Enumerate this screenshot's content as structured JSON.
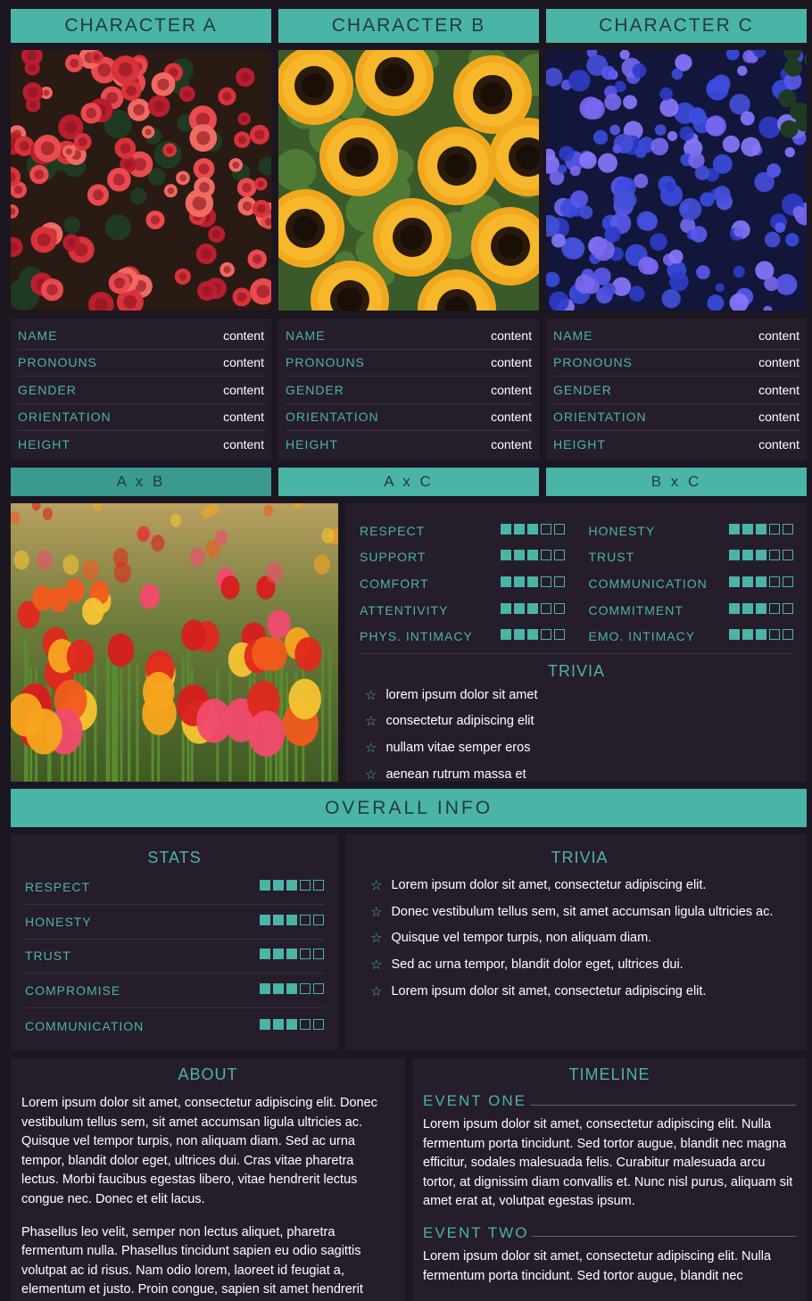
{
  "characters": [
    {
      "title": "CHARACTER A",
      "image": "red-begonia-photo",
      "fields": [
        {
          "label": "NAME",
          "value": "content"
        },
        {
          "label": "PRONOUNS",
          "value": "content"
        },
        {
          "label": "GENDER",
          "value": "content"
        },
        {
          "label": "ORIENTATION",
          "value": "content"
        },
        {
          "label": "HEIGHT",
          "value": "content"
        }
      ]
    },
    {
      "title": "CHARACTER B",
      "image": "sunflower-photo",
      "fields": [
        {
          "label": "NAME",
          "value": "content"
        },
        {
          "label": "PRONOUNS",
          "value": "content"
        },
        {
          "label": "GENDER",
          "value": "content"
        },
        {
          "label": "ORIENTATION",
          "value": "content"
        },
        {
          "label": "HEIGHT",
          "value": "content"
        }
      ]
    },
    {
      "title": "CHARACTER C",
      "image": "blue-hydrangea-photo",
      "fields": [
        {
          "label": "NAME",
          "value": "content"
        },
        {
          "label": "PRONOUNS",
          "value": "content"
        },
        {
          "label": "GENDER",
          "value": "content"
        },
        {
          "label": "ORIENTATION",
          "value": "content"
        },
        {
          "label": "HEIGHT",
          "value": "content"
        }
      ]
    }
  ],
  "relationship_tabs": [
    {
      "label": "A x B",
      "active": true
    },
    {
      "label": "A x C",
      "active": false
    },
    {
      "label": "B x C",
      "active": false
    }
  ],
  "relationship": {
    "image": "tulip-field-photo",
    "stats_left": [
      {
        "label": "RESPECT",
        "level": 3,
        "max": 5
      },
      {
        "label": "SUPPORT",
        "level": 3,
        "max": 5
      },
      {
        "label": "COMFORT",
        "level": 3,
        "max": 5
      },
      {
        "label": "ATTENTIVITY",
        "level": 3,
        "max": 5
      },
      {
        "label": "PHYS. INTIMACY",
        "level": 3,
        "max": 5
      }
    ],
    "stats_right": [
      {
        "label": "HONESTY",
        "level": 3,
        "max": 5
      },
      {
        "label": "TRUST",
        "level": 3,
        "max": 5
      },
      {
        "label": "COMMUNICATION",
        "level": 3,
        "max": 5
      },
      {
        "label": "COMMITMENT",
        "level": 3,
        "max": 5
      },
      {
        "label": "EMO. INTIMACY",
        "level": 3,
        "max": 5
      }
    ],
    "trivia_title": "TRIVIA",
    "trivia": [
      "lorem ipsum dolor sit amet",
      "consectetur adipiscing elit",
      "nullam vitae semper eros",
      "aenean rutrum massa et"
    ]
  },
  "overall": {
    "title": "OVERALL INFO",
    "stats_title": "STATS",
    "stats": [
      {
        "label": "RESPECT",
        "level": 3,
        "max": 5
      },
      {
        "label": "HONESTY",
        "level": 3,
        "max": 5
      },
      {
        "label": "TRUST",
        "level": 3,
        "max": 5
      },
      {
        "label": "COMPROMISE",
        "level": 3,
        "max": 5
      },
      {
        "label": "COMMUNICATION",
        "level": 3,
        "max": 5
      }
    ],
    "trivia_title": "TRIVIA",
    "trivia": [
      "Lorem ipsum dolor sit amet, consectetur adipiscing elit.",
      "Donec vestibulum tellus sem, sit amet accumsan ligula ultricies ac.",
      "Quisque vel tempor turpis, non aliquam diam.",
      "Sed ac urna tempor, blandit dolor eget, ultrices dui.",
      "Lorem ipsum dolor sit amet, consectetur adipiscing elit."
    ]
  },
  "about": {
    "title": "ABOUT",
    "p1": "Lorem ipsum dolor sit amet, consectetur adipiscing elit. Donec vestibulum tellus sem, sit amet accumsan ligula ultricies ac. Quisque vel tempor turpis, non aliquam diam. Sed ac urna tempor, blandit dolor eget, ultrices dui. Cras vitae pharetra lectus. Morbi faucibus egestas libero, vitae hendrerit lectus congue nec. Donec et elit lacus.",
    "p2": "Phasellus leo velit, semper non lectus aliquet, pharetra fermentum nulla. Phasellus tincidunt sapien eu odio sagittis volutpat ac id risus. Nam odio lorem, laoreet id feugiat a, elementum et justo. Proin congue, sapien sit amet hendrerit"
  },
  "timeline": {
    "title": "TIMELINE",
    "events": [
      {
        "title": "EVENT ONE",
        "text": "Lorem ipsum dolor sit amet, consectetur adipiscing elit. Nulla fermentum porta tincidunt. Sed tortor augue, blandit nec magna efficitur, sodales malesuada felis. Curabitur malesuada arcu tortor, at dignissim diam convallis et. Nunc nisl purus, aliquam sit amet erat at, volutpat egestas ipsum."
      },
      {
        "title": "EVENT TWO",
        "text": "Lorem ipsum dolor sit amet, consectetur adipiscing elit. Nulla fermentum porta tincidunt. Sed tortor augue, blandit nec"
      }
    ]
  },
  "colors": {
    "accent": "#4ab5a6",
    "background": "#1b1620",
    "panel": "#261d2a",
    "active_tab": "#3a9a8d"
  }
}
